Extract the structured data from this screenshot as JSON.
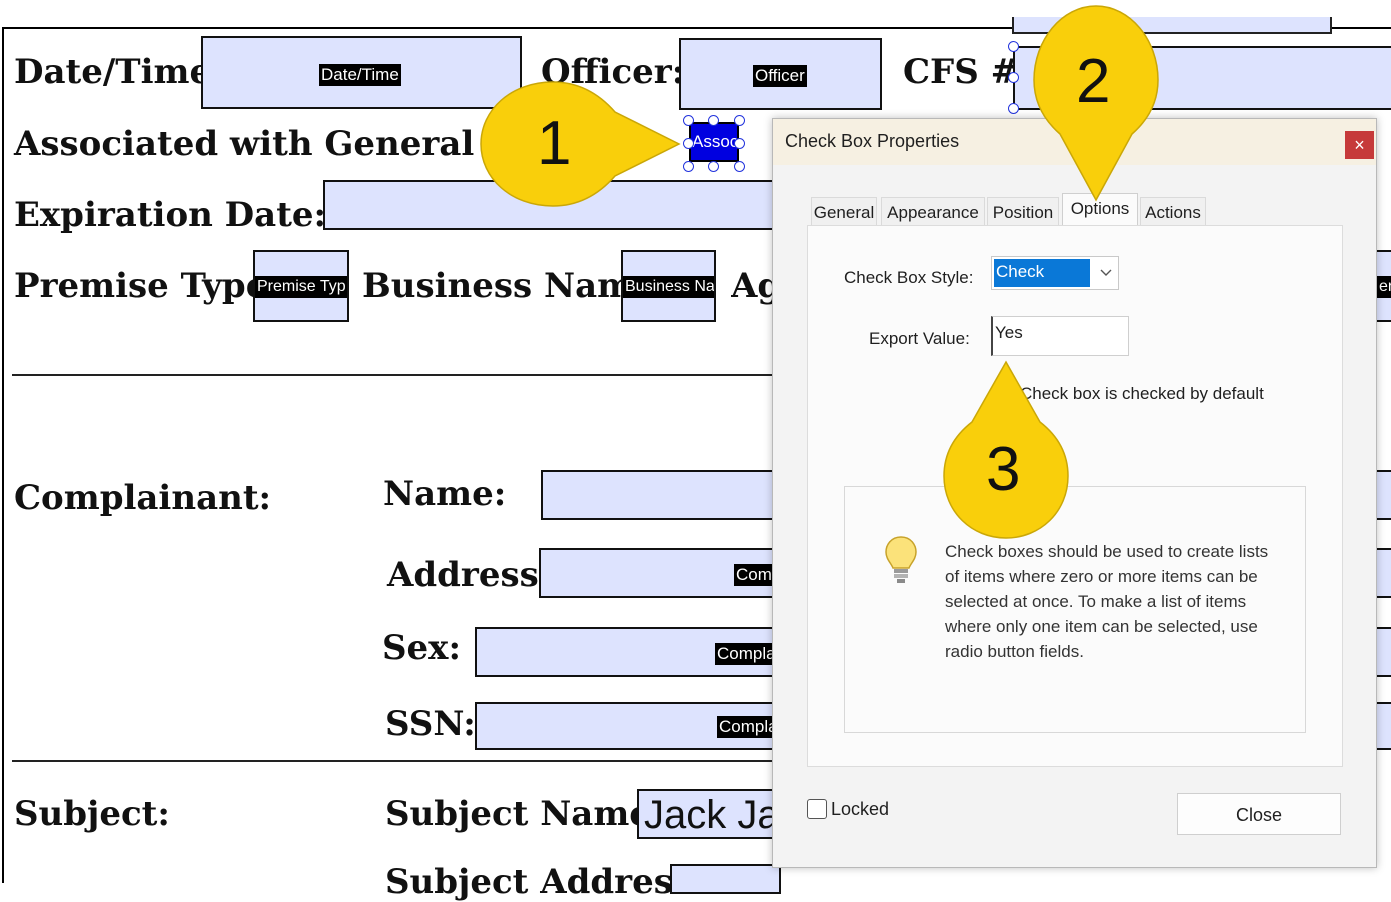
{
  "form": {
    "date_time_label": "Date/Time:",
    "date_time_tag": "Date/Time",
    "officer_label": "Officer:",
    "officer_tag": "Officer",
    "cfs_label": "CFS #",
    "associated_label": "Associated with General Incident:",
    "associated_tag": "Assoc",
    "expiration_label": "Expiration Date:",
    "premise_type_label": "Premise Type:",
    "premise_type_tag": "Premise Typ",
    "business_name_label": "Business Name:",
    "business_name_tag": "Business Na",
    "agency_label": "Age",
    "agency_tag_fragment": "en",
    "complainant_label": "Complainant:",
    "name_label": "Name:",
    "address_label": "Address:",
    "address_tag": "Com",
    "sex_label": "Sex:",
    "sex_tag": "Compla",
    "ssn_label": "SSN:",
    "ssn_tag": "Compla",
    "subject_label": "Subject:",
    "subject_name_label": "Subject Name:",
    "subject_name_value": "Jack Ja",
    "subject_address_label": "Subject Address:"
  },
  "dialog": {
    "title": "Check Box Properties",
    "close_x": "×",
    "tabs": [
      "General",
      "Appearance",
      "Position",
      "Options",
      "Actions"
    ],
    "active_tab": "Options",
    "style_label": "Check Box Style:",
    "style_value": "Check",
    "export_label": "Export Value:",
    "export_value": "Yes",
    "default_checked_label": "Check box is checked by default",
    "info_text": "Check boxes should be used to create lists of items where zero or more items can be selected at once. To make a list of items where only one item can be selected, use radio button fields.",
    "locked_label": "Locked",
    "close_button": "Close"
  },
  "callouts": [
    "1",
    "2",
    "3"
  ],
  "colors": {
    "field_fill": "#dde3fe",
    "selection_blue": "#0000e0",
    "callout_yellow": "#f9cf0b",
    "dropdown_highlight": "#0a78d7",
    "close_red": "#c63a3a"
  }
}
